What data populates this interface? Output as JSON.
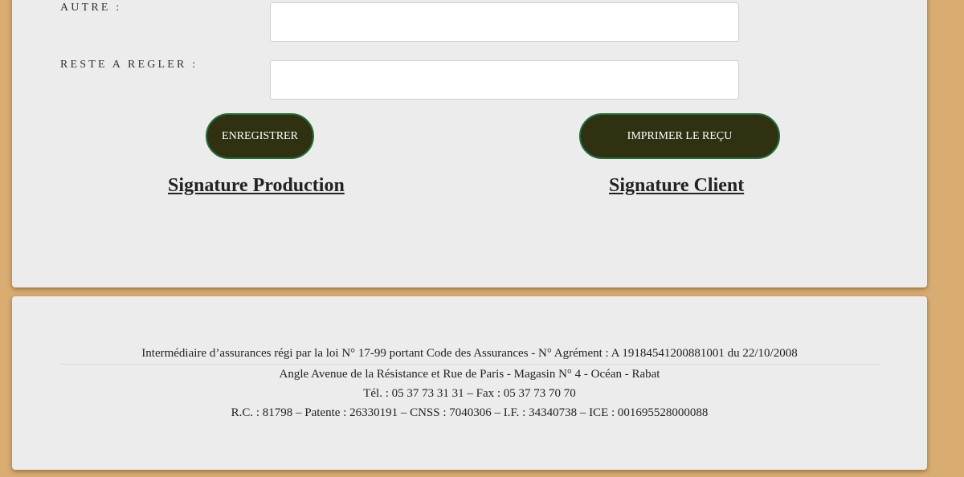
{
  "form": {
    "autre_label": "AUTRE :",
    "autre_value": "",
    "reste_label": "RESTE A REGLER :",
    "reste_value": ""
  },
  "buttons": {
    "save_label": "ENREGISTRER",
    "print_label": "IMPRIMER LE REÇU"
  },
  "signatures": {
    "production": "Signature Production",
    "client": "Signature Client"
  },
  "footer": {
    "line1": "Intermédiaire d’assurances régi par la loi N° 17-99 portant Code des Assurances - N° Agrément : A 19184541200881001 du 22/10/2008",
    "line2": "Angle Avenue de la Résistance et Rue de Paris - Magasin N° 4 - Océan - Rabat",
    "line3": "Tél. : 05 37 73 31 31 – Fax : 05 37 73 70 70",
    "line4": "R.C. : 81798 – Patente : 26330191 – CNSS : 7040306 – I.F. : 34340738 – ICE : 001695528000088"
  },
  "colors": {
    "page_background": "#d9ac72",
    "card_background": "#ececec",
    "button_background": "#2f3110",
    "button_border": "#1e6e3a"
  }
}
